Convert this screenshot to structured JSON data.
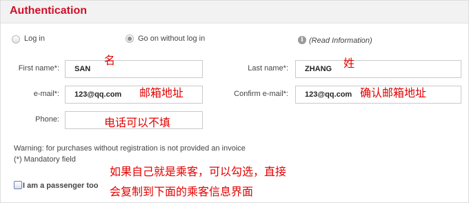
{
  "header": {
    "title": "Authentication"
  },
  "login_options": {
    "log_in": "Log in",
    "go_on_without": "Go on without log in",
    "read_information": "(Read Information)"
  },
  "fields": {
    "first_name": {
      "label": "First name*:",
      "value": "SAN"
    },
    "last_name": {
      "label": "Last name*:",
      "value": "ZHANG"
    },
    "email": {
      "label": "e-mail*:",
      "value": "123@qq.com"
    },
    "confirm_email": {
      "label": "Confirm e-mail*:",
      "value": "123@qq.com"
    },
    "phone": {
      "label": "Phone:",
      "value": ""
    }
  },
  "annotations": {
    "first_name": "名",
    "last_name": "姓",
    "email": "邮箱地址",
    "confirm_email": "确认邮箱地址",
    "phone": "电话可以不填",
    "passenger_line1": "如果自己就是乘客，可以勾选，直接",
    "passenger_line2": "会复制到下面的乘客信息界面"
  },
  "warning": "Warning: for purchases without registration is not provided an invoice",
  "mandatory": "(*) Mandatory field",
  "passenger_checkbox": {
    "label": "I am a passenger too",
    "checked": false
  },
  "colors": {
    "title": "#d0102a",
    "annotation": "#e30000"
  },
  "icons": {
    "info": "info-icon"
  }
}
